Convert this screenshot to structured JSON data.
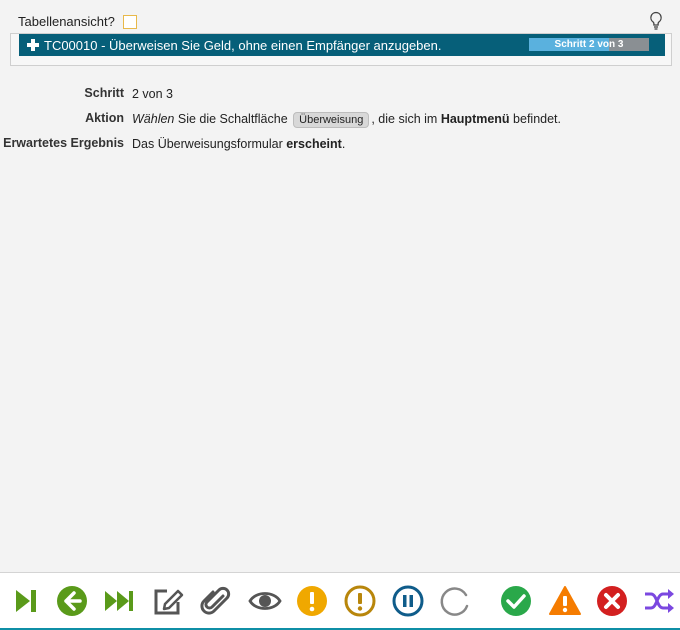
{
  "header": {
    "table_view_label": "Tabellenansicht?"
  },
  "test_case": {
    "title": "TC00010 - Überweisen Sie Geld, ohne einen Empfänger anzugeben.",
    "progress_text": "Schritt 2 von 3",
    "progress_fraction": 0.667
  },
  "details": {
    "schritt_label": "Schritt",
    "schritt_value": "2 von 3",
    "aktion_label": "Aktion",
    "aktion_verb": "Wählen",
    "aktion_part1": " Sie die Schaltfläche ",
    "aktion_button": "Überweisung",
    "aktion_part2": ", die sich im ",
    "aktion_bold": "Hauptmenü",
    "aktion_part3": " befindet.",
    "ergebnis_label": "Erwartetes Ergebnis",
    "ergebnis_part1": "Das Überweisungsformular ",
    "ergebnis_bold": "erscheint",
    "ergebnis_part2": "."
  },
  "toolbar": {
    "icons": [
      "step-next-icon",
      "back-icon",
      "fast-forward-icon",
      "edit-icon",
      "attach-icon",
      "view-icon",
      "warning-circle-icon",
      "warning-outline-icon",
      "pause-icon",
      "loading-icon",
      "check-icon",
      "alert-triangle-icon",
      "fail-icon",
      "shuffle-icon"
    ],
    "colors": {
      "green": "#5a9a1a",
      "gray": "#555555",
      "amber": "#f0a800",
      "amber_dark": "#b8860b",
      "blue": "#0f5c8a",
      "success": "#2aa84a",
      "orange": "#f57c00",
      "red": "#d32020",
      "purple": "#7b48e0"
    }
  }
}
